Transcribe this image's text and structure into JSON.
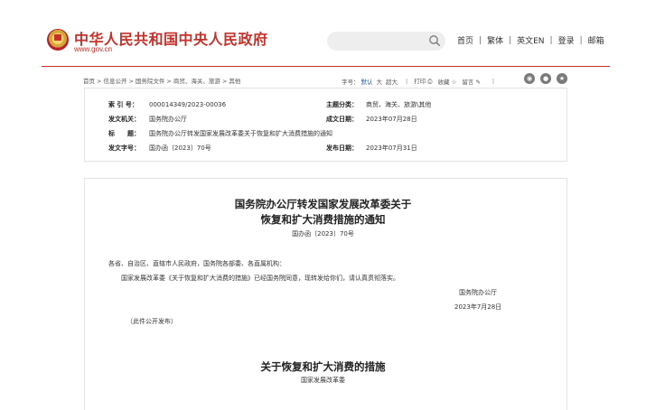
{
  "header": {
    "site_title": "中华人民共和国中央人民政府",
    "site_url": "www.gov.cn",
    "search": {
      "placeholder": ""
    },
    "nav": [
      "首页",
      "繁体",
      "英文EN",
      "登录",
      "邮箱"
    ]
  },
  "breadcrumb": [
    "首页",
    "信息公开",
    "国务院文件",
    "商贸、海关、旅游",
    "其他"
  ],
  "toolbar": {
    "font_label": "字号：",
    "font_default": "默认",
    "font_large": "大",
    "font_xlarge": "超大",
    "print": "打印",
    "favorite": "收藏",
    "comment": "留言"
  },
  "meta": {
    "index_label": "索 引 号：",
    "index_value": "000014349/2023-00036",
    "topic_label": "主题分类：",
    "topic_value": "商贸、海关、旅游\\其他",
    "issuer_label": "发文机关：",
    "issuer_value": "国务院办公厅",
    "date_label": "成文日期：",
    "date_value": "2023年07月28日",
    "title_label": "标　　题：",
    "title_value": "国务院办公厅转发国家发展改革委关于恢复和扩大消费措施的通知",
    "docnum_label": "发文字号：",
    "docnum_value": "国办函〔2023〕70号",
    "publish_label": "发布日期：",
    "publish_value": "2023年07月31日"
  },
  "document": {
    "title_line1": "国务院办公厅转发国家发展改革委关于",
    "title_line2": "恢复和扩大消费措施的通知",
    "doc_number": "国办函〔2023〕70号",
    "salutation": "各省、自治区、直辖市人民政府，国务院各部委、各直属机构：",
    "paragraph": "国家发展改革委《关于恢复和扩大消费的措施》已经国务院同意，现转发给你们，请认真贯彻落实。",
    "signer": "国务院办公厅",
    "sign_date": "2023年7月28日",
    "note": "（此件公开发布）",
    "attachment_title": "关于恢复和扩大消费的措施",
    "attachment_issuer": "国家发展改革委"
  }
}
